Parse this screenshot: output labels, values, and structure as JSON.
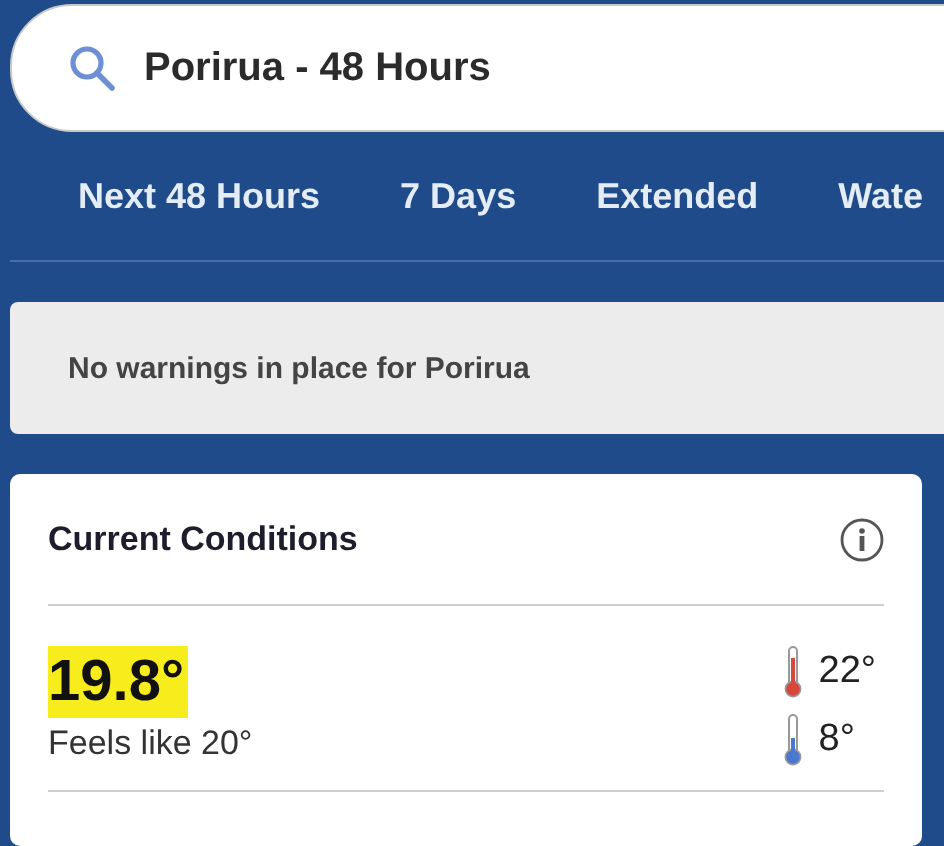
{
  "search": {
    "value": "Porirua - 48 Hours"
  },
  "tabs": [
    {
      "label": "Next 48 Hours"
    },
    {
      "label": "7 Days"
    },
    {
      "label": "Extended"
    },
    {
      "label": "Wate"
    }
  ],
  "warning": "No warnings in place for Porirua",
  "current": {
    "title": "Current Conditions",
    "temperature": "19.8°",
    "highlighted": true,
    "feels_like": "Feels like 20°",
    "high": "22°",
    "low": "8°"
  }
}
